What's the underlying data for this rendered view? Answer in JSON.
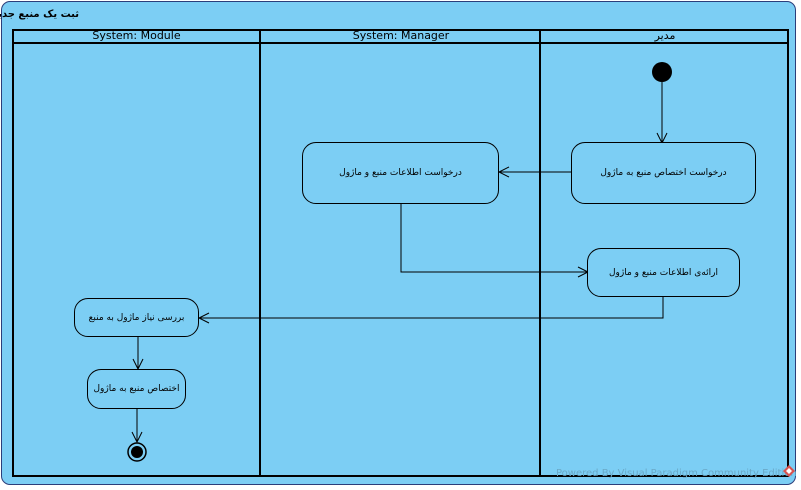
{
  "diagram": {
    "title": "ثبت یک منبع جدید",
    "lanes": [
      {
        "label": "System: Module"
      },
      {
        "label": "System: Manager"
      },
      {
        "label": "مدیر"
      }
    ],
    "actions": [
      {
        "label": "درخواست اختصاص منبع به ماژول"
      },
      {
        "label": "درخواست اطلاعات منبع و ماژول"
      },
      {
        "label": "ارائه‌ی اطلاعات منبع و ماژول"
      },
      {
        "label": "بررسی نیاز ماژول به منبع"
      },
      {
        "label": "اختصاص منبع به ماژول"
      }
    ],
    "watermark": "Powered By  Visual Paradigm Community Edition",
    "colors": {
      "background": "#7ccef4",
      "line": "#000000",
      "logo": "#d9534f"
    }
  }
}
